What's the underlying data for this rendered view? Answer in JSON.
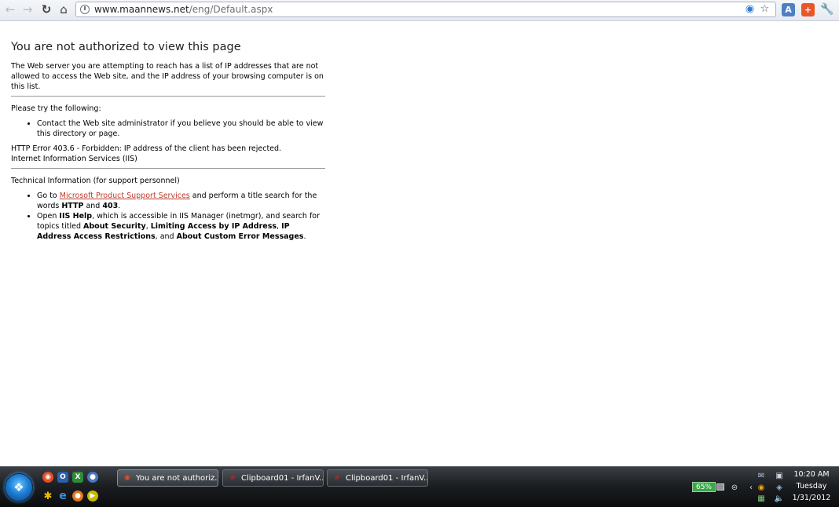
{
  "browser": {
    "url_host": "www.maannews.net",
    "url_path": "/eng/Default.aspx",
    "icons": {
      "back": "back-arrow-icon",
      "forward": "forward-arrow-icon",
      "reload": "reload-icon",
      "home": "home-icon",
      "site_info": "page-info-icon",
      "star": "bookmark-star-icon",
      "wrench": "wrench-icon"
    }
  },
  "page": {
    "title": "You are not authorized to view this page",
    "intro": "The Web server you are attempting to reach has a list of IP addresses that are not allowed to access the Web site, and the IP address of your browsing computer is on this list.",
    "try_heading": "Please try the following:",
    "try_item": "Contact the Web site administrator if you believe you should be able to view this directory or page.",
    "error_line": "HTTP Error 403.6 - Forbidden: IP address of the client has been rejected.",
    "iis_line": "Internet Information Services (IIS)",
    "tech_heading": "Technical Information (for support personnel)",
    "tech_item1": {
      "pre": "Go to ",
      "link": "Microsoft Product Support Services",
      "mid": " and perform a title search for the words ",
      "b1": "HTTP",
      "and": " and ",
      "b2": "403",
      "end": "."
    },
    "tech_item2": {
      "pre": "Open ",
      "b1": "IIS Help",
      "mid": ", which is accessible in IIS Manager (inetmgr), and search for topics titled ",
      "b2": "About Security",
      "sep1": ", ",
      "b3": "Limiting Access by IP Address",
      "sep2": ", ",
      "b4": "IP Address Access Restrictions",
      "sep3": ", and ",
      "b5": "About Custom Error Messages",
      "end": "."
    }
  },
  "taskbar": {
    "tasks": [
      {
        "label": "You are not authoriz...",
        "icon": "chrome-icon",
        "active": true
      },
      {
        "label": "Clipboard01 - IrfanV...",
        "icon": "irfanview-icon",
        "active": false
      },
      {
        "label": "Clipboard01 - IrfanV...",
        "icon": "irfanview-icon",
        "active": false
      }
    ],
    "battery": "65%",
    "clock": {
      "time": "10:20 AM",
      "day": "Tuesday",
      "date": "1/31/2012"
    }
  },
  "colors": {
    "link": "#c0392b",
    "taskbar": "#1c1f22",
    "battery": "#3aa84a"
  }
}
